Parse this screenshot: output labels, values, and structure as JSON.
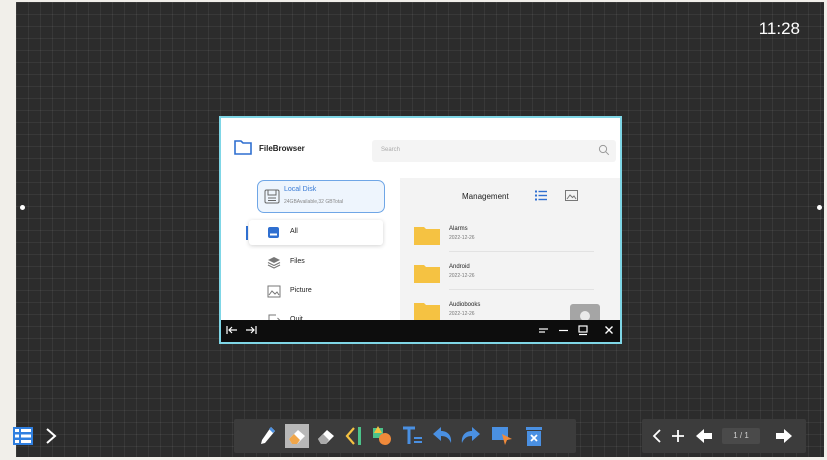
{
  "clock": "11:28",
  "file_browser": {
    "title": "FileBrowser",
    "search_placeholder": "Search",
    "disk": {
      "name": "Local Disk",
      "info": "24GBAvailable,32 GBTotal"
    },
    "sidebar": [
      {
        "label": "All",
        "icon": "drive-icon",
        "selected": true
      },
      {
        "label": "Files",
        "icon": "layers-icon"
      },
      {
        "label": "Picture",
        "icon": "image-icon"
      },
      {
        "label": "Quit",
        "icon": "exit-icon"
      }
    ],
    "main": {
      "heading": "Management",
      "files": [
        {
          "name": "Alarms",
          "date": "2022-12-26"
        },
        {
          "name": "Android",
          "date": "2022-12-26"
        },
        {
          "name": "Audiobooks",
          "date": "2022-12-26"
        }
      ]
    }
  },
  "window_bar": {
    "icons": [
      "dock-left-icon",
      "dock-right-icon",
      "menu-icon",
      "minimize-icon",
      "maximize-icon",
      "close-icon"
    ]
  },
  "toolbar": {
    "tools": [
      "pen-icon",
      "eraser-icon",
      "clear-eraser-icon",
      "ruler-icon",
      "shapes-icon",
      "text-icon",
      "undo-icon",
      "redo-icon",
      "select-icon",
      "delete-icon"
    ]
  },
  "pager": {
    "page": "1 / 1"
  },
  "colors": {
    "accent": "#2f6fd0",
    "folder": "#f5c242",
    "toolbar_bg": "#3c3c3c",
    "canvas_bg": "#2c2c2c"
  }
}
